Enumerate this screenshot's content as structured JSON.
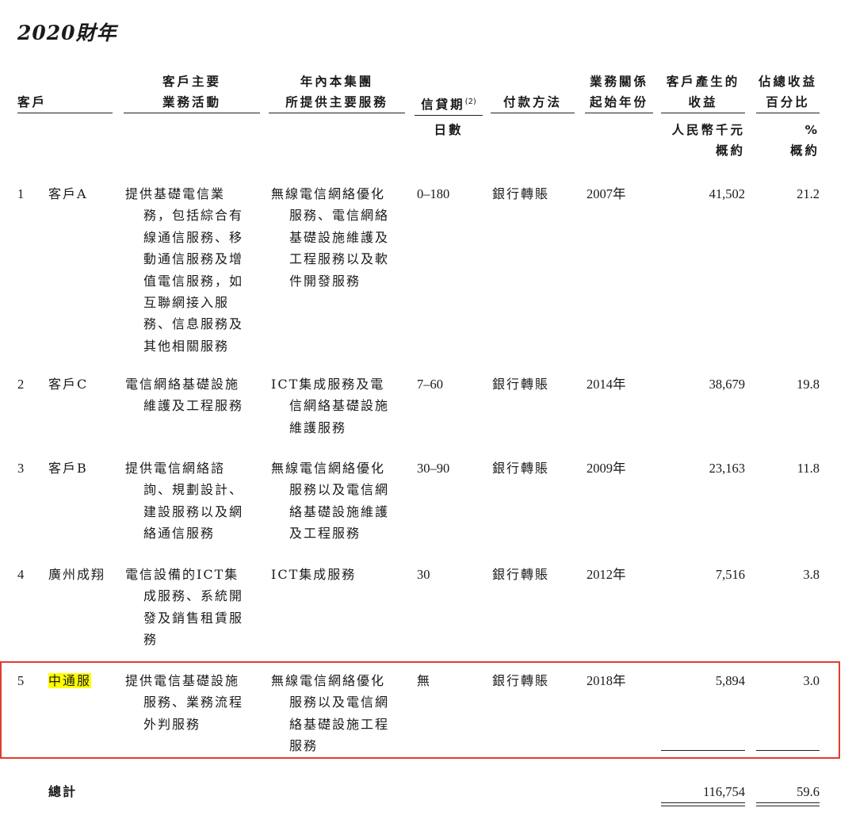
{
  "title": "2020財年",
  "headers": {
    "customer": "客戶",
    "business": [
      "客戶主要",
      "業務活動"
    ],
    "services": [
      "年內本集團",
      "所提供主要服務"
    ],
    "credit": "信貸期",
    "credit_sup": "(2)",
    "payment": "付款方法",
    "start_year": [
      "業務關係",
      "起始年份"
    ],
    "revenue": [
      "客戶產生的",
      "收益"
    ],
    "pct": [
      "佔總收益",
      "百分比"
    ]
  },
  "units": {
    "credit": "日數",
    "revenue": [
      "人民幣千元",
      "概約"
    ],
    "pct": [
      "%",
      "概約"
    ]
  },
  "rows": [
    {
      "no": "1",
      "name": "客戶A",
      "business": [
        "提供基礎電信業",
        "務，包括綜合有",
        "線通信服務、移",
        "動通信服務及增",
        "值電信服務，如",
        "互聯網接入服",
        "務、信息服務及",
        "其他相關服務"
      ],
      "services": [
        "無線電信網絡優化",
        "服務、電信網絡",
        "基礎設施維護及",
        "工程服務以及軟",
        "件開發服務"
      ],
      "credit": "0–180",
      "payment": "銀行轉賬",
      "year": "2007年",
      "revenue": "41,502",
      "pct": "21.2"
    },
    {
      "no": "2",
      "name": "客戶C",
      "business": [
        "電信網絡基礎設施",
        "維護及工程服務"
      ],
      "services": [
        "ICT集成服務及電",
        "信網絡基礎設施",
        "維護服務"
      ],
      "credit": "7–60",
      "payment": "銀行轉賬",
      "year": "2014年",
      "revenue": "38,679",
      "pct": "19.8"
    },
    {
      "no": "3",
      "name": "客戶B",
      "business": [
        "提供電信網絡諮",
        "詢、規劃設計、",
        "建設服務以及網",
        "絡通信服務"
      ],
      "services": [
        "無線電信網絡優化",
        "服務以及電信網",
        "絡基礎設施維護",
        "及工程服務"
      ],
      "credit": "30–90",
      "payment": "銀行轉賬",
      "year": "2009年",
      "revenue": "23,163",
      "pct": "11.8"
    },
    {
      "no": "4",
      "name": "廣州成翔",
      "business": [
        "電信設備的ICT集",
        "成服務、系統開",
        "發及銷售租賃服",
        "務"
      ],
      "services": [
        "ICT集成服務"
      ],
      "credit": "30",
      "payment": "銀行轉賬",
      "year": "2012年",
      "revenue": "7,516",
      "pct": "3.8"
    },
    {
      "no": "5",
      "name": "中通服",
      "business": [
        "提供電信基礎設施",
        "服務、業務流程",
        "外判服務"
      ],
      "services": [
        "無線電信網絡優化",
        "服務以及電信網",
        "絡基礎設施工程",
        "服務"
      ],
      "credit": "無",
      "payment": "銀行轉賬",
      "year": "2018年",
      "revenue": "5,894",
      "pct": "3.0"
    }
  ],
  "total": {
    "label": "總計",
    "revenue": "116,754",
    "pct": "59.6"
  },
  "colors": {
    "highlight": "#ffff00",
    "box": "#e03c31"
  }
}
